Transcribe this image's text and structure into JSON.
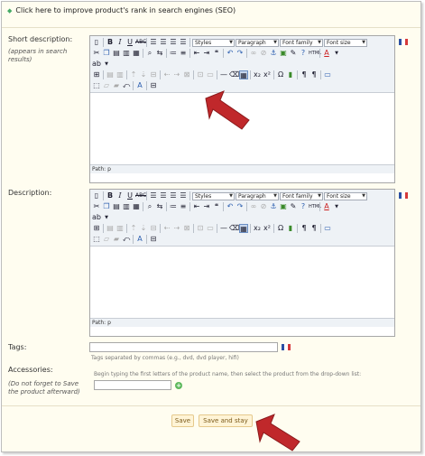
{
  "seo": {
    "text": "Click here to improve product's rank in search engines (SEO)"
  },
  "short_description": {
    "label": "Short description:",
    "sublabel": "(appears in search results)",
    "path": "Path: p"
  },
  "description": {
    "label": "Description:",
    "path": "Path: p"
  },
  "toolbar": {
    "styles": "Styles",
    "paragraph": "Paragraph",
    "font_family": "Font family",
    "font_size": "Font size"
  },
  "tags": {
    "label": "Tags:",
    "hint": "Tags separated by commas (e.g., dvd, dvd player, hifi)",
    "value": ""
  },
  "accessories": {
    "label": "Accessories:",
    "sublabel": "(Do not forget to Save the product afterward)",
    "hint": "Begin typing the first letters of the product name, then select the product from the drop-down list:",
    "value": ""
  },
  "buttons": {
    "save": "Save",
    "save_and_stay": "Save and stay"
  },
  "colors": {
    "background": "#fffdf0",
    "pointer_arrow": "#c0282b",
    "button_bg": "#fff4d6",
    "flag_blue": "#2b4fa3",
    "flag_white": "#ffffff",
    "flag_red": "#d63a3a"
  }
}
